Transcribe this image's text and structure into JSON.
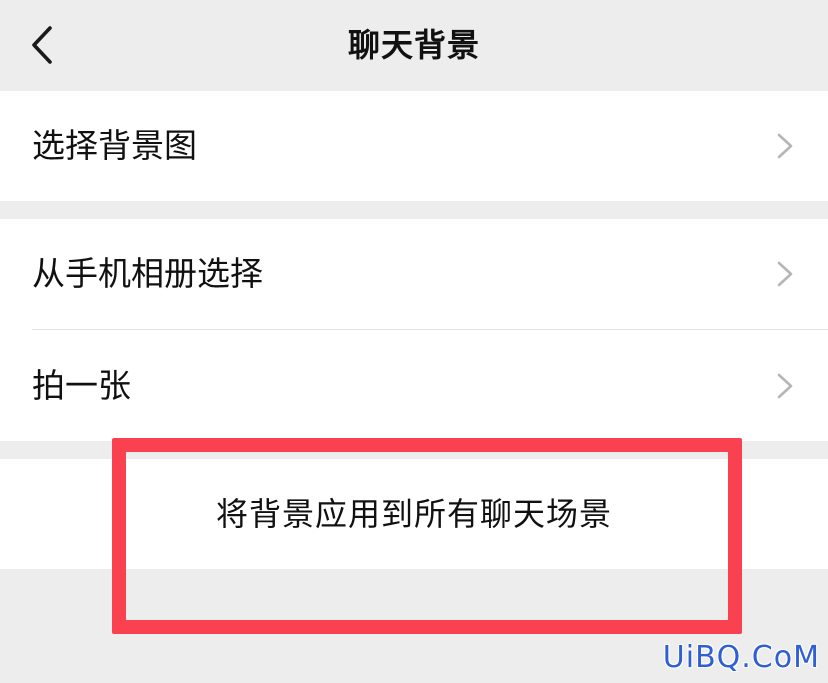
{
  "header": {
    "title": "聊天背景",
    "back_icon": "chevron-left-icon"
  },
  "menu": {
    "select_background": "选择背景图",
    "from_album": "从手机相册选择",
    "take_photo": "拍一张",
    "apply_all": "将背景应用到所有聊天场景",
    "row_icon": "chevron-right-icon"
  },
  "annotation": {
    "highlight_color": "#f9414f"
  },
  "watermark": {
    "text": "UiBQ.CoM",
    "color": "#2f5fd3"
  }
}
